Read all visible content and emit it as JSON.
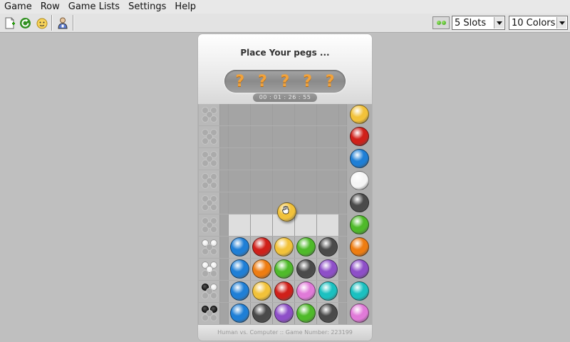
{
  "menu": [
    "Game",
    "Row",
    "Game Lists",
    "Settings",
    "Help"
  ],
  "toolbar": {
    "icons": [
      "new-game-icon",
      "refresh-icon",
      "smiley-icon",
      "info-icon"
    ],
    "slots_label": "5 Slots",
    "colors_label": "10 Colors"
  },
  "board": {
    "status": "Place Your pegs ...",
    "secret": [
      "?",
      "?",
      "?",
      "?",
      "?"
    ],
    "timer": "00 : 01 : 26 : 55",
    "footer": "Human vs. Computer :: Game Number: 223199",
    "palette": [
      "#f2c23a",
      "#d0201a",
      "#1f7fd6",
      "#f5f5f5",
      "#4a4a4a",
      "#4fba2a",
      "#ee7d12",
      "#8e4fc8",
      "#1bc0c0",
      "#e07ad8"
    ],
    "guesses": [
      {
        "pegs": [
          "#1f7fd6",
          "#d0201a",
          "#f2c23a",
          "#4fba2a",
          "#4a4a4a"
        ],
        "hints": [
          "white",
          "white",
          "empty",
          "empty",
          "empty"
        ]
      },
      {
        "pegs": [
          "#1f7fd6",
          "#ee7d12",
          "#4fba2a",
          "#4a4a4a",
          "#8e4fc8"
        ],
        "hints": [
          "white",
          "white",
          "white",
          "empty",
          "empty"
        ]
      },
      {
        "pegs": [
          "#1f7fd6",
          "#f2c23a",
          "#d0201a",
          "#e07ad8",
          "#1bc0c0"
        ],
        "hints": [
          "black",
          "white",
          "empty",
          "empty",
          "empty"
        ]
      },
      {
        "pegs": [
          "#1f7fd6",
          "#4a4a4a",
          "#8e4fc8",
          "#4fba2a",
          "#4a4a4a"
        ],
        "hints": [
          "black",
          "black",
          "empty",
          "empty",
          "empty"
        ]
      }
    ],
    "dragged_peg": "#f2c23a"
  }
}
